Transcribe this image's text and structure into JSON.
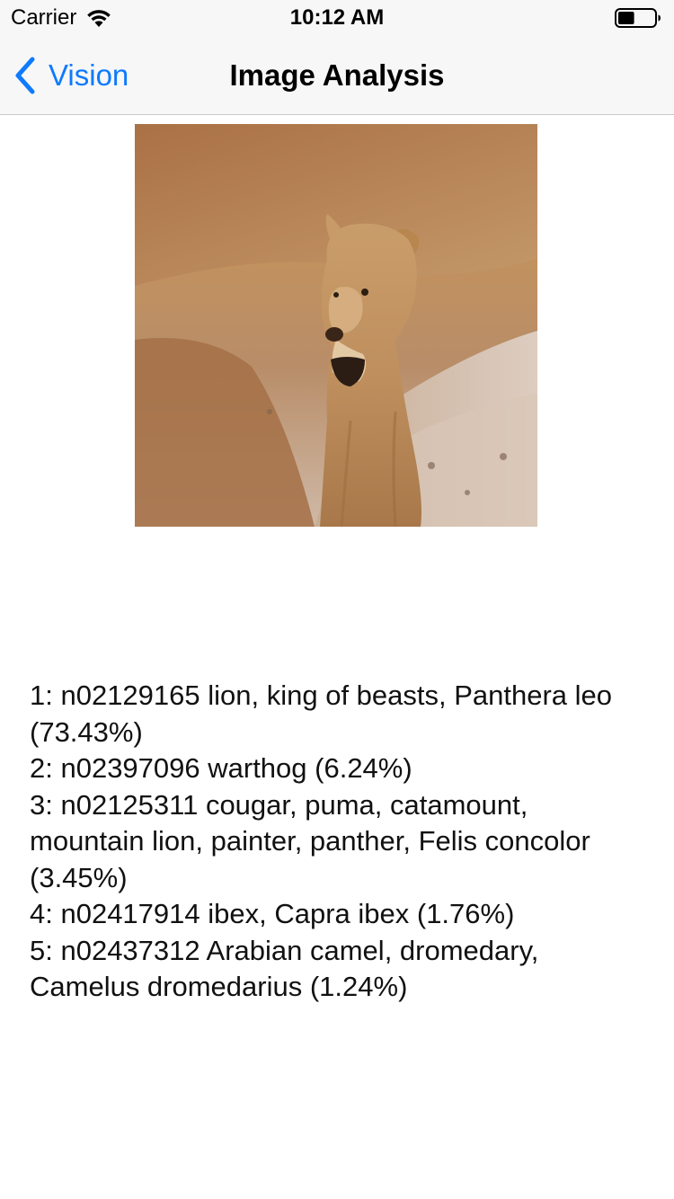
{
  "status_bar": {
    "carrier": "Carrier",
    "time": "10:12 AM",
    "wifi_icon": "wifi-icon",
    "battery_icon": "battery-icon",
    "battery_level": 0.45
  },
  "nav": {
    "back_label": "Vision",
    "back_icon": "chevron-left-icon",
    "title": "Image Analysis",
    "accent_color": "#0e7afe"
  },
  "image": {
    "subject": "lioness"
  },
  "results": [
    "1: n02129165 lion, king of beasts, Panthera leo (73.43%)",
    "2: n02397096 warthog (6.24%)",
    "3: n02125311 cougar, puma, catamount, mountain lion, painter, panther, Felis concolor (3.45%)",
    "4: n02417914 ibex, Capra ibex (1.76%)",
    "5: n02437312 Arabian camel, dromedary, Camelus dromedarius (1.24%)"
  ]
}
